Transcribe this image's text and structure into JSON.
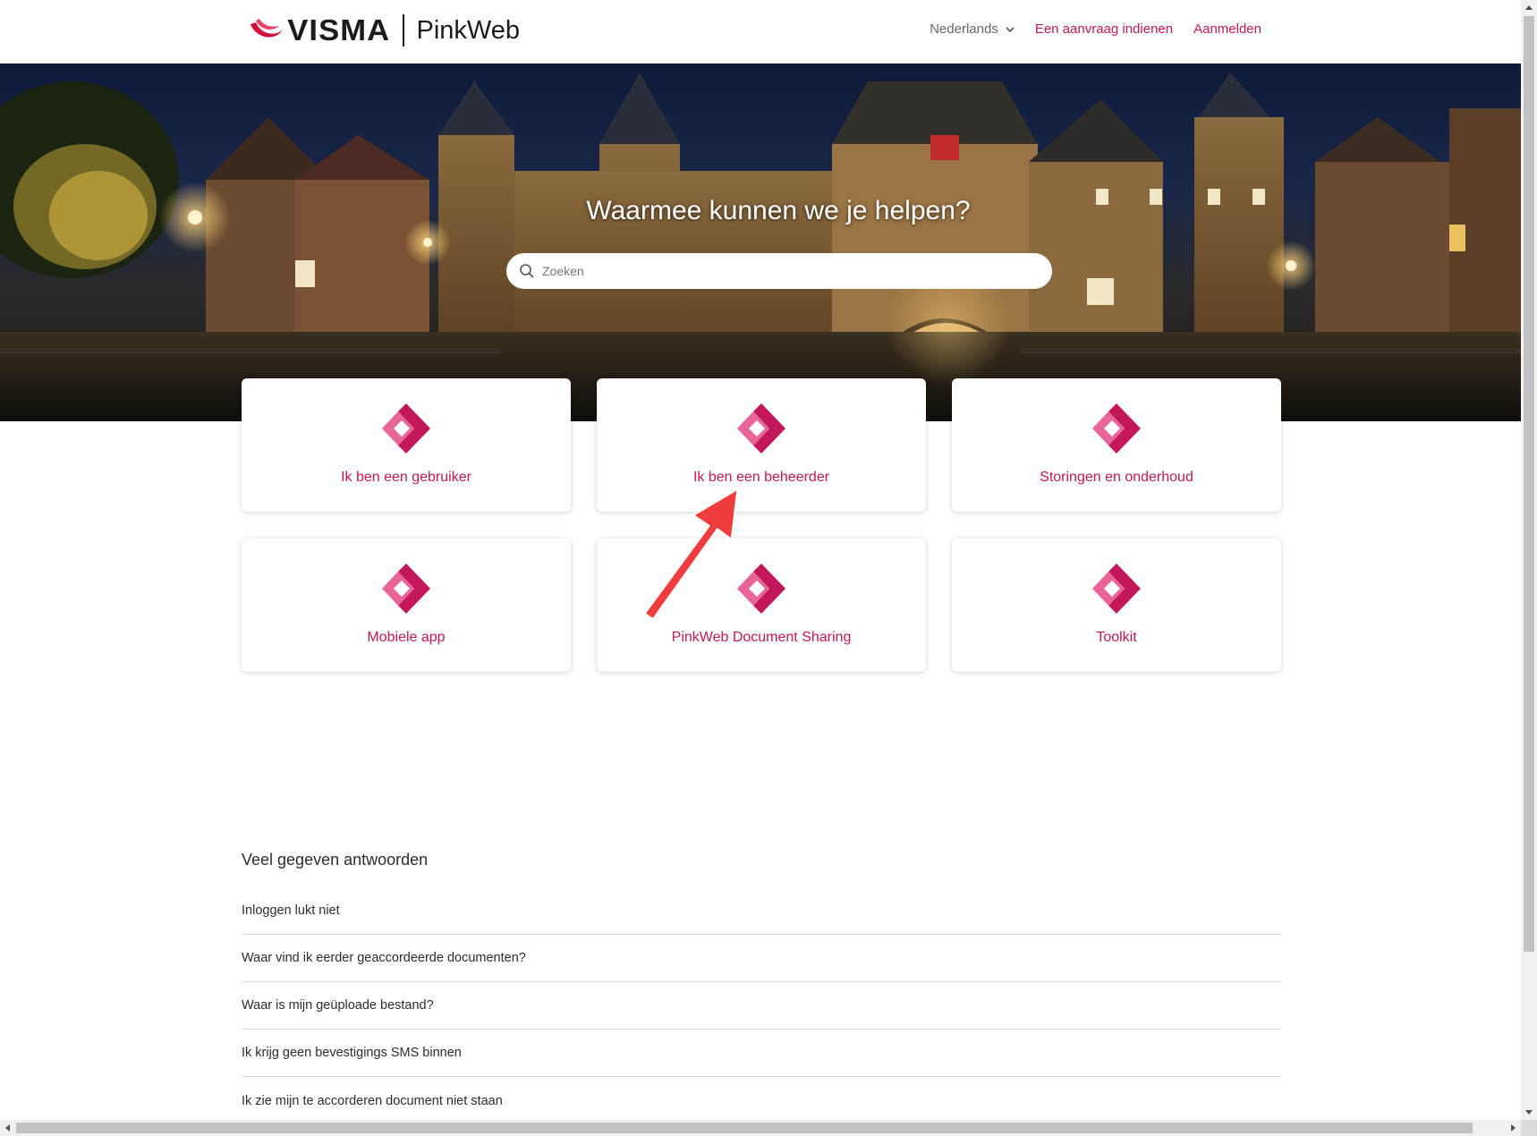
{
  "colors": {
    "brand": "#c2185b",
    "brand_light": "#e8659a",
    "text": "#2d2d2d"
  },
  "header": {
    "logo_word": "VISMA",
    "product_name": "PinkWeb",
    "language": "Nederlands",
    "submit_request": "Een aanvraag indienen",
    "sign_in": "Aanmelden"
  },
  "hero": {
    "title": "Waarmee kunnen we je helpen?",
    "search_placeholder": "Zoeken"
  },
  "cards": [
    {
      "label": "Ik ben een gebruiker",
      "icon": "pinkweb-logo-icon"
    },
    {
      "label": "Ik ben een beheerder",
      "icon": "pinkweb-logo-icon"
    },
    {
      "label": "Storingen en onderhoud",
      "icon": "pinkweb-logo-icon"
    },
    {
      "label": "Mobiele app",
      "icon": "pinkweb-logo-icon"
    },
    {
      "label": "PinkWeb Document Sharing",
      "icon": "pinkweb-logo-icon"
    },
    {
      "label": "Toolkit",
      "icon": "pinkweb-logo-icon"
    }
  ],
  "faq": {
    "title": "Veel gegeven antwoorden",
    "items": [
      "Inloggen lukt niet",
      "Waar vind ik eerder geaccordeerde documenten?",
      "Waar is mijn geüploade bestand?",
      "Ik krijg geen bevestigings SMS binnen",
      "Ik zie mijn te accorderen document niet staan"
    ]
  }
}
